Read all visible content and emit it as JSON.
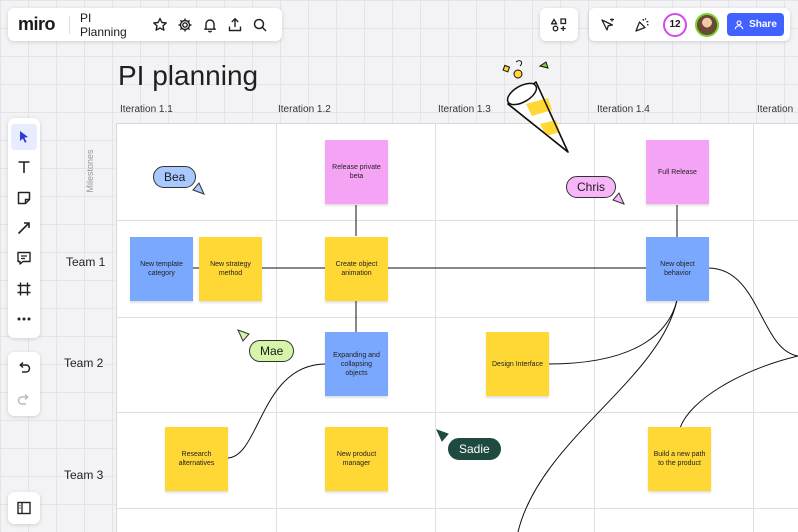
{
  "header": {
    "logo": "miro",
    "board_name": "PI Planning",
    "collaborator_count": "12",
    "share_label": "Share"
  },
  "icons": [
    "star-icon",
    "gear-icon",
    "bell-icon",
    "upload-icon",
    "search-icon",
    "apps-icon",
    "reactions-icon",
    "party-icon",
    "user-icon"
  ],
  "canvas": {
    "title": "PI planning",
    "iterations": [
      "Iteration 1.1",
      "Iteration 1.2",
      "Iteration 1.3",
      "Iteration 1.4",
      "Iteration"
    ],
    "rows": {
      "milestones": "Milestones",
      "team1": "Team 1",
      "team2": "Team 2",
      "team3": "Team 3"
    },
    "notes": {
      "release_private_beta": "Release private beta",
      "full_release": "Full Release",
      "new_template_category": "New template category",
      "new_strategy_method": "New strategy method",
      "create_object_animation": "Create object animation",
      "new_object_behavior": "New object behavior",
      "expanding_collapsing": "Expanding and collapsing objects",
      "design_interface": "Design Interface",
      "research_alternatives": "Research alternatives",
      "new_product_manager": "New product manager",
      "build_new_path": "Build a new path to the product"
    },
    "cursors": {
      "bea": "Bea",
      "chris": "Chris",
      "mae": "Mae",
      "sadie": "Sadie"
    }
  },
  "colors": {
    "accent": "#4262ff",
    "sticky_yellow": "#ffd836",
    "sticky_pink": "#f5a3f5",
    "sticky_blue": "#7aa8ff",
    "cursor_bea": "#a8c8ff",
    "cursor_chris": "#f7b6f7",
    "cursor_mae": "#d6f5a8",
    "cursor_sadie": "#1f4a42"
  }
}
